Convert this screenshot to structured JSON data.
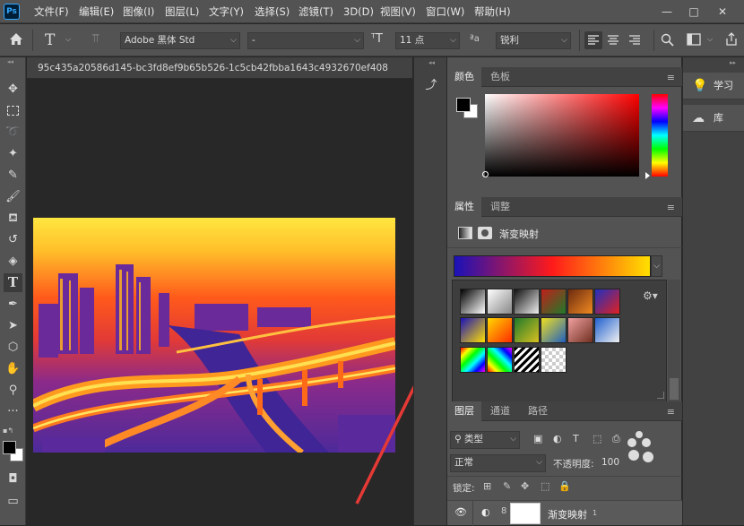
{
  "menubar": {
    "logo": "Ps",
    "items": [
      "文件(F)",
      "编辑(E)",
      "图像(I)",
      "图层(L)",
      "文字(Y)",
      "选择(S)",
      "滤镜(T)",
      "3D(D)",
      "视图(V)",
      "窗口(W)",
      "帮助(H)"
    ],
    "minimize": "—",
    "maximize": "□",
    "close": "✕"
  },
  "options": {
    "home_icon": "home-icon",
    "font_family": "Adobe 黑体 Std",
    "font_style": "-",
    "font_size": "11 点",
    "antialias": "锐利",
    "aa_label": "ªa"
  },
  "document": {
    "tab_title": "95c435a20586d145-bc3fd8ef9b65b526-1c5cb42fbba1643c4932670ef408"
  },
  "color_panel": {
    "tabs": [
      "颜色",
      "色板"
    ],
    "foreground": "#000000",
    "background": "#ffffff"
  },
  "properties_panel": {
    "tabs": [
      "属性",
      "调整"
    ],
    "title": "渐变映射",
    "gradient_colors": [
      "#1a12b8",
      "#ff1a1a",
      "#ffe000"
    ]
  },
  "gradient_presets": {
    "gear_icon": "gear-icon",
    "swatches": [
      [
        "#000",
        "#fff"
      ],
      [
        "#fff",
        "#888"
      ],
      [
        "#111",
        "#eee"
      ],
      [
        "#c0201a",
        "#1f7a2a"
      ],
      [
        "#6b2a10",
        "#f08a20"
      ],
      [
        "#2030c0",
        "#e02020"
      ],
      [
        "#1a12b8",
        "#ffe000"
      ],
      [
        "#ffd800",
        "#ff2a00"
      ],
      [
        "#1f7a2a",
        "#d8c020"
      ],
      [
        "#f0e020",
        "#2060c0"
      ],
      [
        "#f0a0a0",
        "#703020"
      ],
      [
        "#2060d0",
        "#f0f0f0"
      ],
      [
        "#ff0000",
        "#0000ff"
      ],
      [
        "#00ff00",
        "#ff00ff"
      ],
      [
        "#000",
        "#fff"
      ],
      [
        "#ccc",
        "#fff"
      ]
    ]
  },
  "layers_panel": {
    "tabs": [
      "图层",
      "通道",
      "路径"
    ],
    "filter_type": "类型",
    "blend_mode": "正常",
    "opacity_label": "不透明度:",
    "opacity_value": "100",
    "lock_label": "锁定:",
    "layer_name": "渐变映射",
    "layer_index": "1"
  },
  "right_dock": {
    "learn_label": "学习",
    "library_label": "库"
  }
}
